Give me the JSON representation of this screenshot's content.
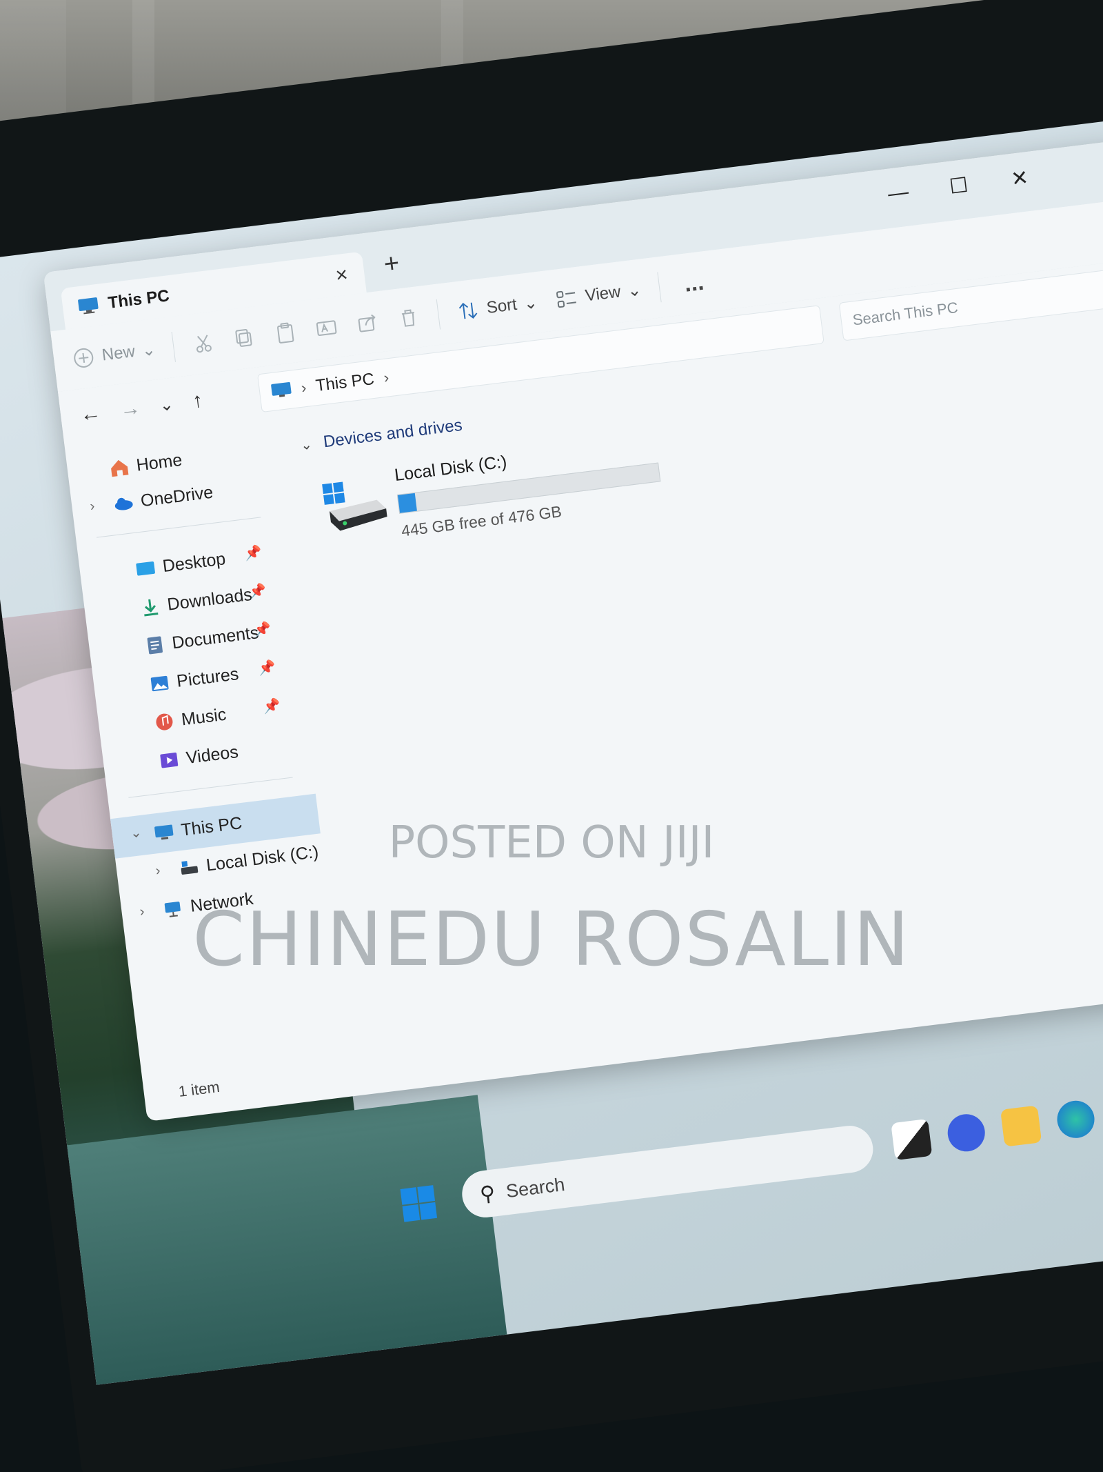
{
  "window": {
    "tab_title": "This PC",
    "tab_close": "×",
    "new_tab": "+",
    "minimize": "—",
    "maximize": "☐",
    "close": "✕"
  },
  "toolbar": {
    "new_label": "New",
    "sort_label": "Sort",
    "view_label": "View",
    "more_label": "..."
  },
  "address": {
    "crumb": "This PC",
    "search_placeholder": "Search This PC"
  },
  "sidebar": {
    "home": "Home",
    "onedrive": "OneDrive",
    "quick_access": [
      "Desktop",
      "Downloads",
      "Documents",
      "Pictures",
      "Music",
      "Videos"
    ],
    "this_pc": "This PC",
    "local_disk": "Local Disk (C:)",
    "network": "Network"
  },
  "content": {
    "section_title": "Devices and drives",
    "drive_name": "Local Disk (C:)",
    "drive_free": "445 GB free of 476 GB",
    "drive_used_fraction": 0.065
  },
  "status": {
    "item_count": "1 item"
  },
  "taskbar": {
    "search_label": "Search"
  },
  "watermark": {
    "line1": "POSTED ON JIJI",
    "line2": "CHINEDU ROSALIN"
  },
  "colors": {
    "accent": "#2b8fe0",
    "selection": "#c9deef"
  }
}
